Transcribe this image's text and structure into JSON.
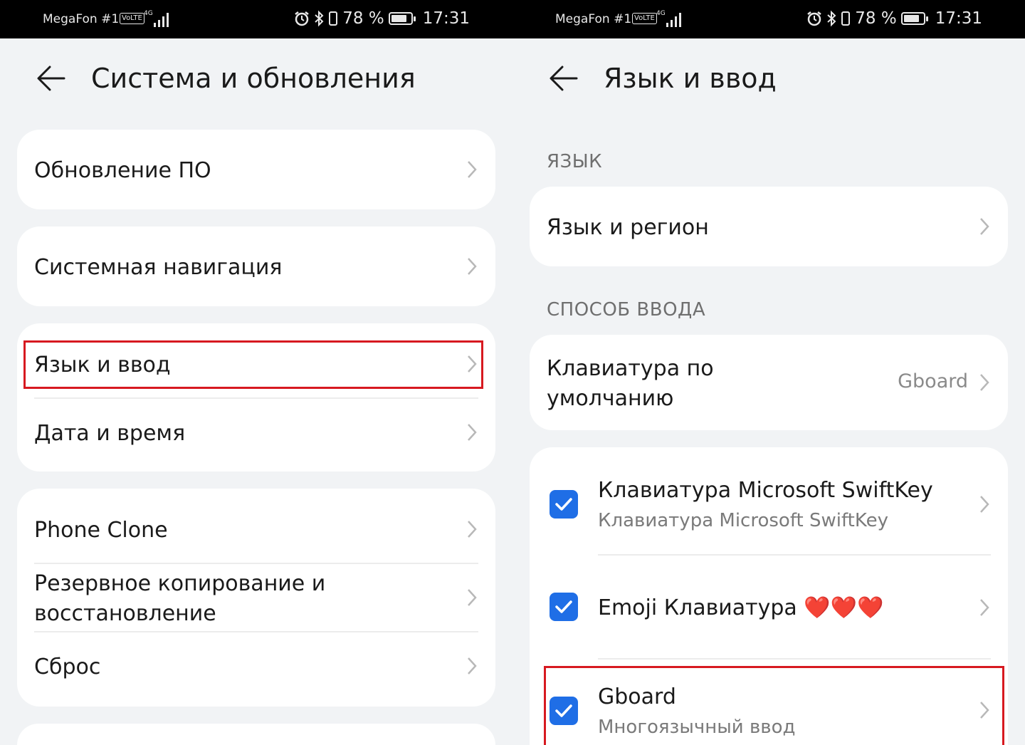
{
  "status_bar": {
    "carrier": "MegaFon #1",
    "volte": "VoLTE",
    "network": "4G",
    "battery": "78 %",
    "time": "17:31"
  },
  "left": {
    "title": "Система и обновления",
    "items": [
      {
        "label": "Обновление ПО"
      },
      {
        "label": "Системная навигация"
      },
      {
        "label": "Язык и ввод"
      },
      {
        "label": "Дата и время"
      },
      {
        "label": "Phone Clone"
      },
      {
        "label": "Резервное копирование и восстановление"
      },
      {
        "label": "Сброс"
      }
    ]
  },
  "right": {
    "title": "Язык и ввод",
    "section_language": "ЯЗЫК",
    "lang_region": "Язык и регион",
    "section_input": "СПОСОБ ВВОДА",
    "default_keyboard_label": "Клавиатура по умолчанию",
    "default_keyboard_value": "Gboard",
    "keyboards": [
      {
        "name": "Клавиатура Microsoft SwiftKey",
        "subtitle": "Клавиатура Microsoft SwiftKey",
        "checked": true
      },
      {
        "name": "Emoji Клавиатура ❤️❤️❤️",
        "subtitle": "",
        "checked": true
      },
      {
        "name": "Gboard",
        "subtitle": "Многоязычный ввод",
        "checked": true
      }
    ]
  },
  "colors": {
    "highlight": "#d71920",
    "checkbox": "#1f6ee6",
    "background": "#f1f3f5",
    "card": "#ffffff"
  },
  "icons": [
    "back-arrow-icon",
    "chevron-right-icon",
    "alarm-icon",
    "bluetooth-icon",
    "vibrate-icon",
    "battery-icon",
    "signal-icon",
    "check-icon",
    "heart-icon"
  ]
}
